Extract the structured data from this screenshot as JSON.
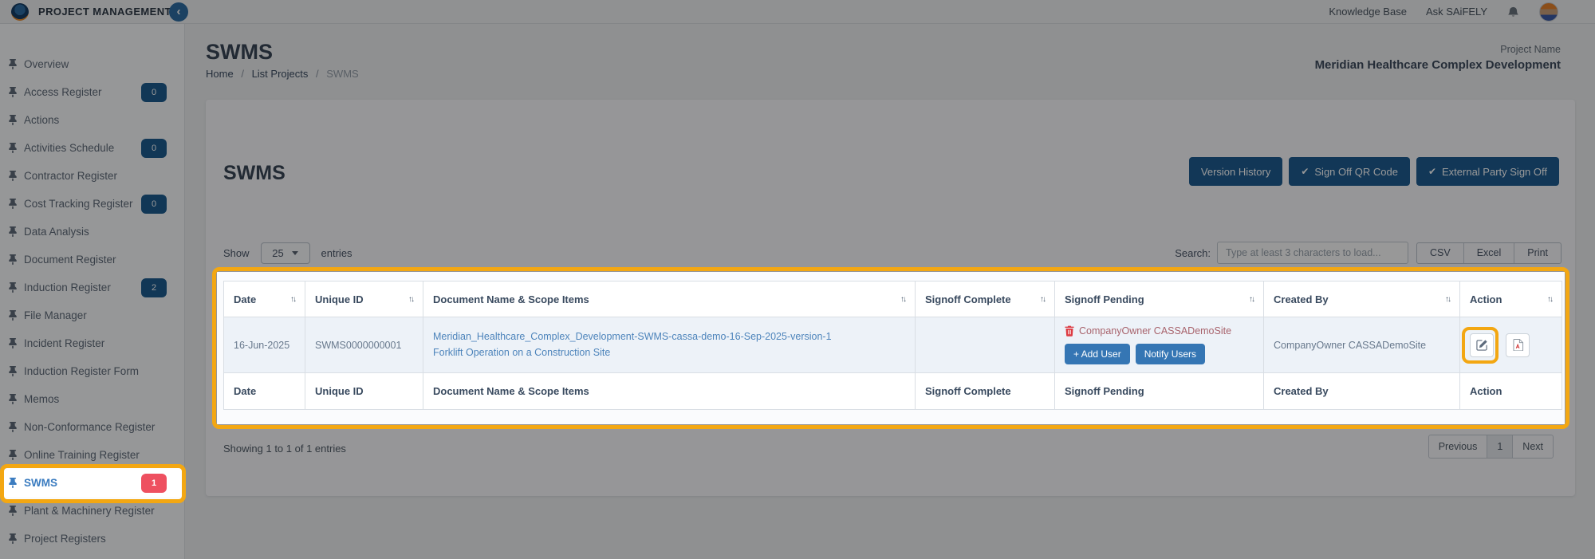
{
  "colors": {
    "highlight": "#f3a712",
    "primary_dark_button": "#1e5d92",
    "primary_button": "#3576b4",
    "badge_blue": "#1d5c8f",
    "badge_red": "#ee5060",
    "link_blue": "#4d84bb",
    "trash_red": "#dd3b42",
    "row_background": "#edf2f8"
  },
  "topbar": {
    "app_title": "PROJECT MANAGEMENT",
    "knowledge_base": "Knowledge Base",
    "ask": "Ask SAiFELY"
  },
  "sidebar": {
    "items": [
      {
        "label": "Overview"
      },
      {
        "label": "Access Register",
        "badge": "0",
        "badge_color": "#1d5c8f"
      },
      {
        "label": "Actions"
      },
      {
        "label": "Activities Schedule",
        "badge": "0",
        "badge_color": "#1d5c8f"
      },
      {
        "label": "Contractor Register"
      },
      {
        "label": "Cost Tracking Register",
        "badge": "0",
        "badge_color": "#1d5c8f"
      },
      {
        "label": "Data Analysis"
      },
      {
        "label": "Document Register"
      },
      {
        "label": "Induction Register",
        "badge": "2",
        "badge_color": "#1d5c8f"
      },
      {
        "label": "File Manager"
      },
      {
        "label": "Incident Register"
      },
      {
        "label": "Induction Register Form"
      },
      {
        "label": "Memos"
      },
      {
        "label": "Non-Conformance Register"
      },
      {
        "label": "Online Training Register"
      },
      {
        "label": "SWMS",
        "badge": "1",
        "badge_color": "#ee5060",
        "active": true
      },
      {
        "label": "Plant & Machinery Register"
      },
      {
        "label": "Project Registers"
      }
    ]
  },
  "page": {
    "title": "SWMS",
    "breadcrumb": {
      "home": "Home",
      "list_projects": "List Projects",
      "current": "SWMS",
      "separator": "/"
    },
    "project_label": "Project Name",
    "project_name": "Meridian Healthcare Complex Development"
  },
  "card": {
    "heading": "SWMS",
    "actions": [
      {
        "label": "Version History"
      },
      {
        "label": "Sign Off QR Code",
        "icon": "check"
      },
      {
        "label": "External Party Sign Off",
        "icon": "check"
      }
    ],
    "show": {
      "label": "Show",
      "value": "25",
      "suffix": "entries"
    },
    "search": {
      "label": "Search:",
      "placeholder": "Type at least 3 characters to load..."
    },
    "export_buttons": [
      "CSV",
      "Excel",
      "Print"
    ],
    "table": {
      "sort_icon": "↑↓",
      "columns": [
        "Date",
        "Unique ID",
        "Document Name & Scope Items",
        "Signoff Complete",
        "Signoff Pending",
        "Created By",
        "Action"
      ],
      "row": {
        "date": "16-Jun-2025",
        "unique_id": "SWMS0000000001",
        "doc_name": "Meridian_Healthcare_Complex_Development-SWMS-cassa-demo-16-Sep-2025-version-1",
        "doc_scope": "Forklift Operation on a Construction Site",
        "signoff_complete": "",
        "pending_user": "CompanyOwner CASSADemoSite",
        "add_user_label": "+ Add User",
        "notify_label": "Notify Users",
        "created_by": "CompanyOwner CASSADemoSite"
      }
    },
    "footer": {
      "showing": "Showing 1 to 1 of 1 entries"
    },
    "pagination": {
      "previous": "Previous",
      "page": "1",
      "next": "Next"
    }
  }
}
